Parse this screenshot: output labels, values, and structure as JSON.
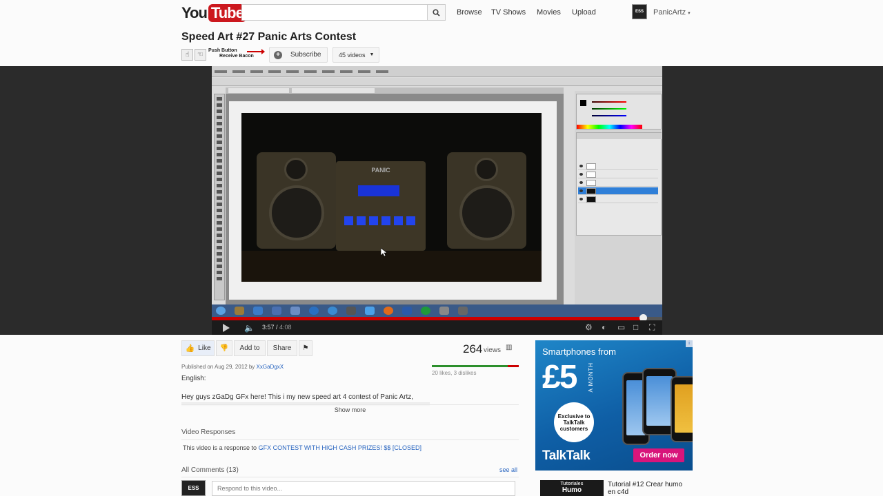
{
  "header": {
    "logo_you": "You",
    "logo_tube": "Tube",
    "search_placeholder": "",
    "nav": [
      {
        "label": "Browse"
      },
      {
        "label": "TV Shows"
      },
      {
        "label": "Movies"
      },
      {
        "label": "Upload"
      }
    ],
    "avatar_text": "ESS",
    "username": "PanicArtz"
  },
  "video": {
    "title": "Speed Art #27 Panic Arts Contest",
    "promo_line1": "Push Button",
    "promo_line2": "Receive Bacon",
    "subscribe_label": "Subscribe",
    "videos_label": "45 videos",
    "art_label": "PANIC",
    "current_time": "3:57",
    "duration": "4:08",
    "progress": 0.957
  },
  "actions": {
    "like": "Like",
    "add_to": "Add to",
    "share": "Share"
  },
  "stats": {
    "views": "264",
    "views_label": "views",
    "likes_text": "20 likes, 3 dislikes",
    "likes": 20,
    "dislikes": 3
  },
  "description": {
    "published_prefix": "Published on Aug 29, 2012 by",
    "author": "XxGaDgxX",
    "language": "English:",
    "text": "Hey guys zGaDg GFx here! This i my new speed art 4 contest of Panic Artz,",
    "show_more": "Show more"
  },
  "responses": {
    "title": "Video Responses",
    "prefix": "This video is a response to",
    "link": "GFX CONTEST WITH HIGH CASH PRIZES! $$ [CLOSED]"
  },
  "comments": {
    "title": "All Comments (13)",
    "see_all": "see all",
    "avatar_text": "ESS",
    "input_placeholder": "Respond to this video..."
  },
  "ad": {
    "badge": "i",
    "headline": "Smartphones from",
    "price": "£5",
    "period": "A MONTH",
    "circle_text": "Exclusive to TalkTalk customers",
    "brand": "TalkTalk",
    "cta": "Order now"
  },
  "related": [
    {
      "thumb_top": "Tutoriales",
      "thumb_big": "Humo",
      "title": "Tutorial #12 Crear humo en c4d"
    }
  ],
  "colors": {
    "youtube_red": "#cc181e",
    "link_blue": "#2a66c0",
    "like_green": "#2c8f2c",
    "dislike_red": "#cc0000",
    "ad_blue": "#1f86c8",
    "ad_pink": "#d8157b"
  }
}
